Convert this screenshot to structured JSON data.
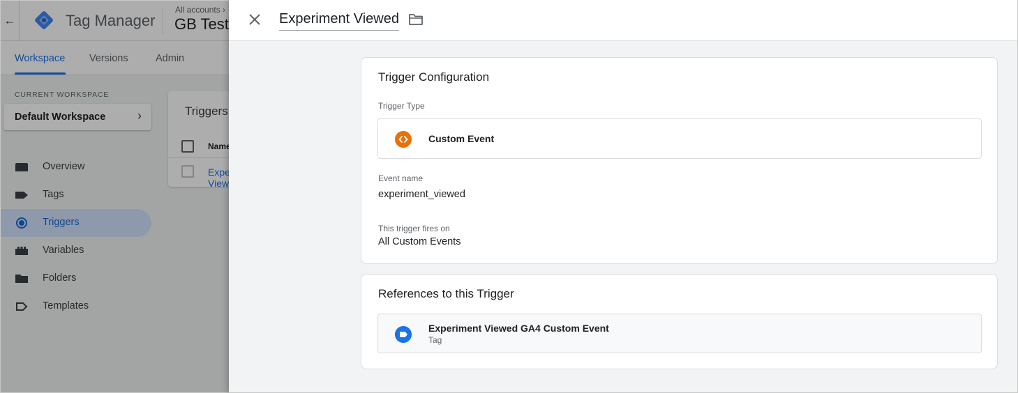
{
  "app": {
    "product_name": "Tag Manager",
    "account_path": "All accounts ›",
    "container_name": "GB Testing"
  },
  "nav": {
    "tabs": [
      {
        "label": "Workspace",
        "active": true
      },
      {
        "label": "Versions",
        "active": false
      },
      {
        "label": "Admin",
        "active": false
      }
    ]
  },
  "workspace": {
    "section_label": "CURRENT WORKSPACE",
    "name": "Default Workspace"
  },
  "sidebar": {
    "items": [
      {
        "label": "Overview",
        "icon": "overview-icon",
        "active": false
      },
      {
        "label": "Tags",
        "icon": "tag-icon",
        "active": false
      },
      {
        "label": "Triggers",
        "icon": "trigger-icon",
        "active": true
      },
      {
        "label": "Variables",
        "icon": "variables-icon",
        "active": false
      },
      {
        "label": "Folders",
        "icon": "folder-icon",
        "active": false
      },
      {
        "label": "Templates",
        "icon": "template-icon",
        "active": false
      }
    ]
  },
  "triggers_list": {
    "title": "Triggers",
    "column_name": "Name",
    "rows": [
      {
        "name": "Experiment Viewed"
      }
    ]
  },
  "panel": {
    "title": "Experiment Viewed",
    "config": {
      "title": "Trigger Configuration",
      "type_label": "Trigger Type",
      "type_name": "Custom Event",
      "event_name_label": "Event name",
      "event_name_value": "experiment_viewed",
      "fires_on_label": "This trigger fires on",
      "fires_on_value": "All Custom Events"
    },
    "references": {
      "title": "References to this Trigger",
      "items": [
        {
          "name": "Experiment Viewed GA4 Custom Event",
          "type": "Tag"
        }
      ]
    }
  },
  "colors": {
    "accent": "#1a73e8",
    "custom_event_icon": "#e8710a",
    "tag_icon": "#1a73e8",
    "active_nav_bg": "#d2e3fc"
  }
}
